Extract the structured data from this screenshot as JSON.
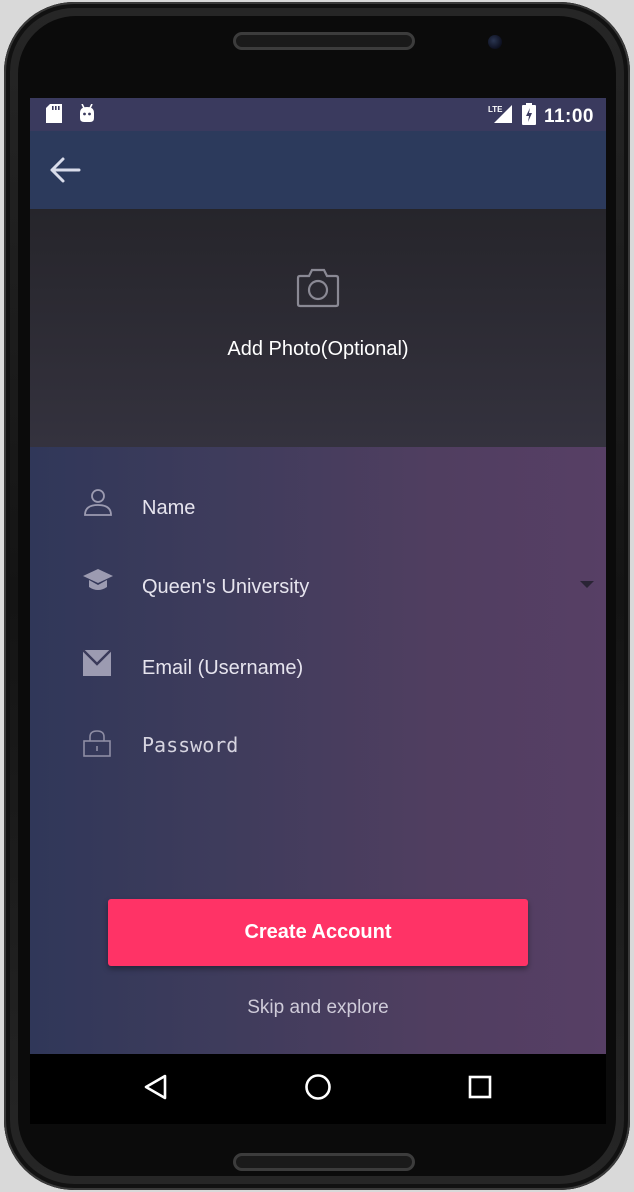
{
  "status_bar": {
    "time": "11:00",
    "network": "LTE",
    "icons": [
      "sd-card-icon",
      "android-debug-icon",
      "lte-signal-icon",
      "battery-charging-icon"
    ]
  },
  "app_bar": {
    "back_icon": "arrow-back-icon"
  },
  "photo": {
    "icon": "camera-icon",
    "label": "Add Photo(Optional)"
  },
  "form": {
    "name_placeholder": "Name",
    "university_value": "Queen's University",
    "email_placeholder": "Email (Username)",
    "password_placeholder": "Password",
    "create_label": "Create Account",
    "skip_label": "Skip and explore"
  },
  "nav_bar": {
    "icons": [
      "back-triangle-icon",
      "home-circle-icon",
      "recents-square-icon"
    ]
  },
  "colors": {
    "accent": "#ff3366",
    "app_bar": "#2c3a5c",
    "status_bar": "#3a3a5e",
    "gradient_start": "#303759",
    "gradient_end": "#573f65"
  }
}
